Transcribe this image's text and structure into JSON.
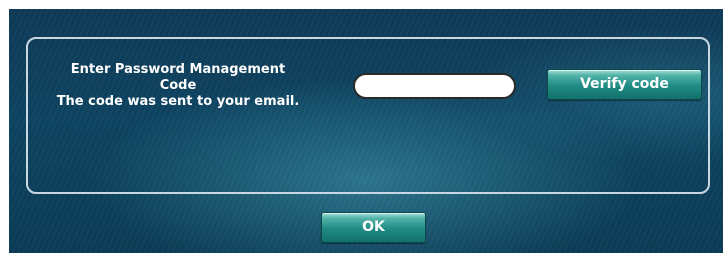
{
  "dialog": {
    "prompt_line1": "Enter Password Management",
    "prompt_line2": "Code",
    "prompt_line3": "The code was sent to your email.",
    "code_input": {
      "value": "",
      "placeholder": ""
    },
    "verify_label": "Verify code",
    "ok_label": "OK"
  },
  "colors": {
    "background": "#0d4461",
    "button": "#1f8b84",
    "panel_border": "#c9d7e0",
    "text": "#ffffff"
  }
}
